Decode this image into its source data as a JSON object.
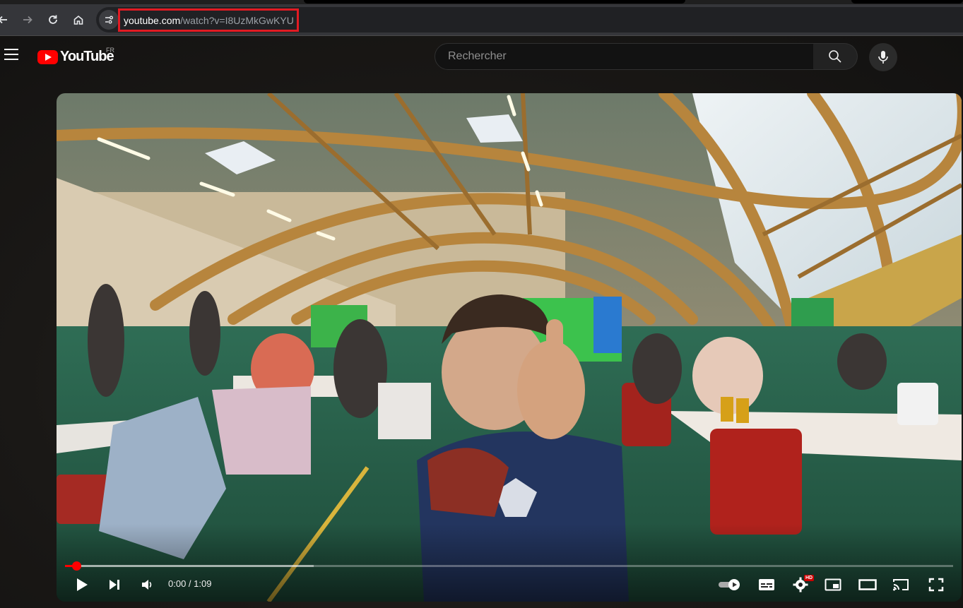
{
  "browser": {
    "url_host": "youtube.com",
    "url_path": "/watch?v=I8UzMkGwKYU",
    "highlight_color": "#e21b23",
    "nav_icons": [
      "back-arrow-icon",
      "forward-arrow-icon",
      "reload-icon",
      "home-icon",
      "site-info-icon"
    ]
  },
  "header": {
    "logo_text": "YouTube",
    "country_code": "FR",
    "search_placeholder": "Rechercher",
    "brand_color": "#ff0000"
  },
  "player": {
    "time_display": "0:00 / 1:09",
    "progress_fraction": 0.0,
    "buffered_fraction": 0.28,
    "settings_badge": "HD",
    "control_icons": [
      "play-icon",
      "next-icon",
      "volume-icon",
      "autoplay-toggle-icon",
      "subtitles-icon",
      "settings-icon",
      "miniplayer-icon",
      "theater-mode-icon",
      "cast-icon",
      "fullscreen-icon"
    ]
  }
}
